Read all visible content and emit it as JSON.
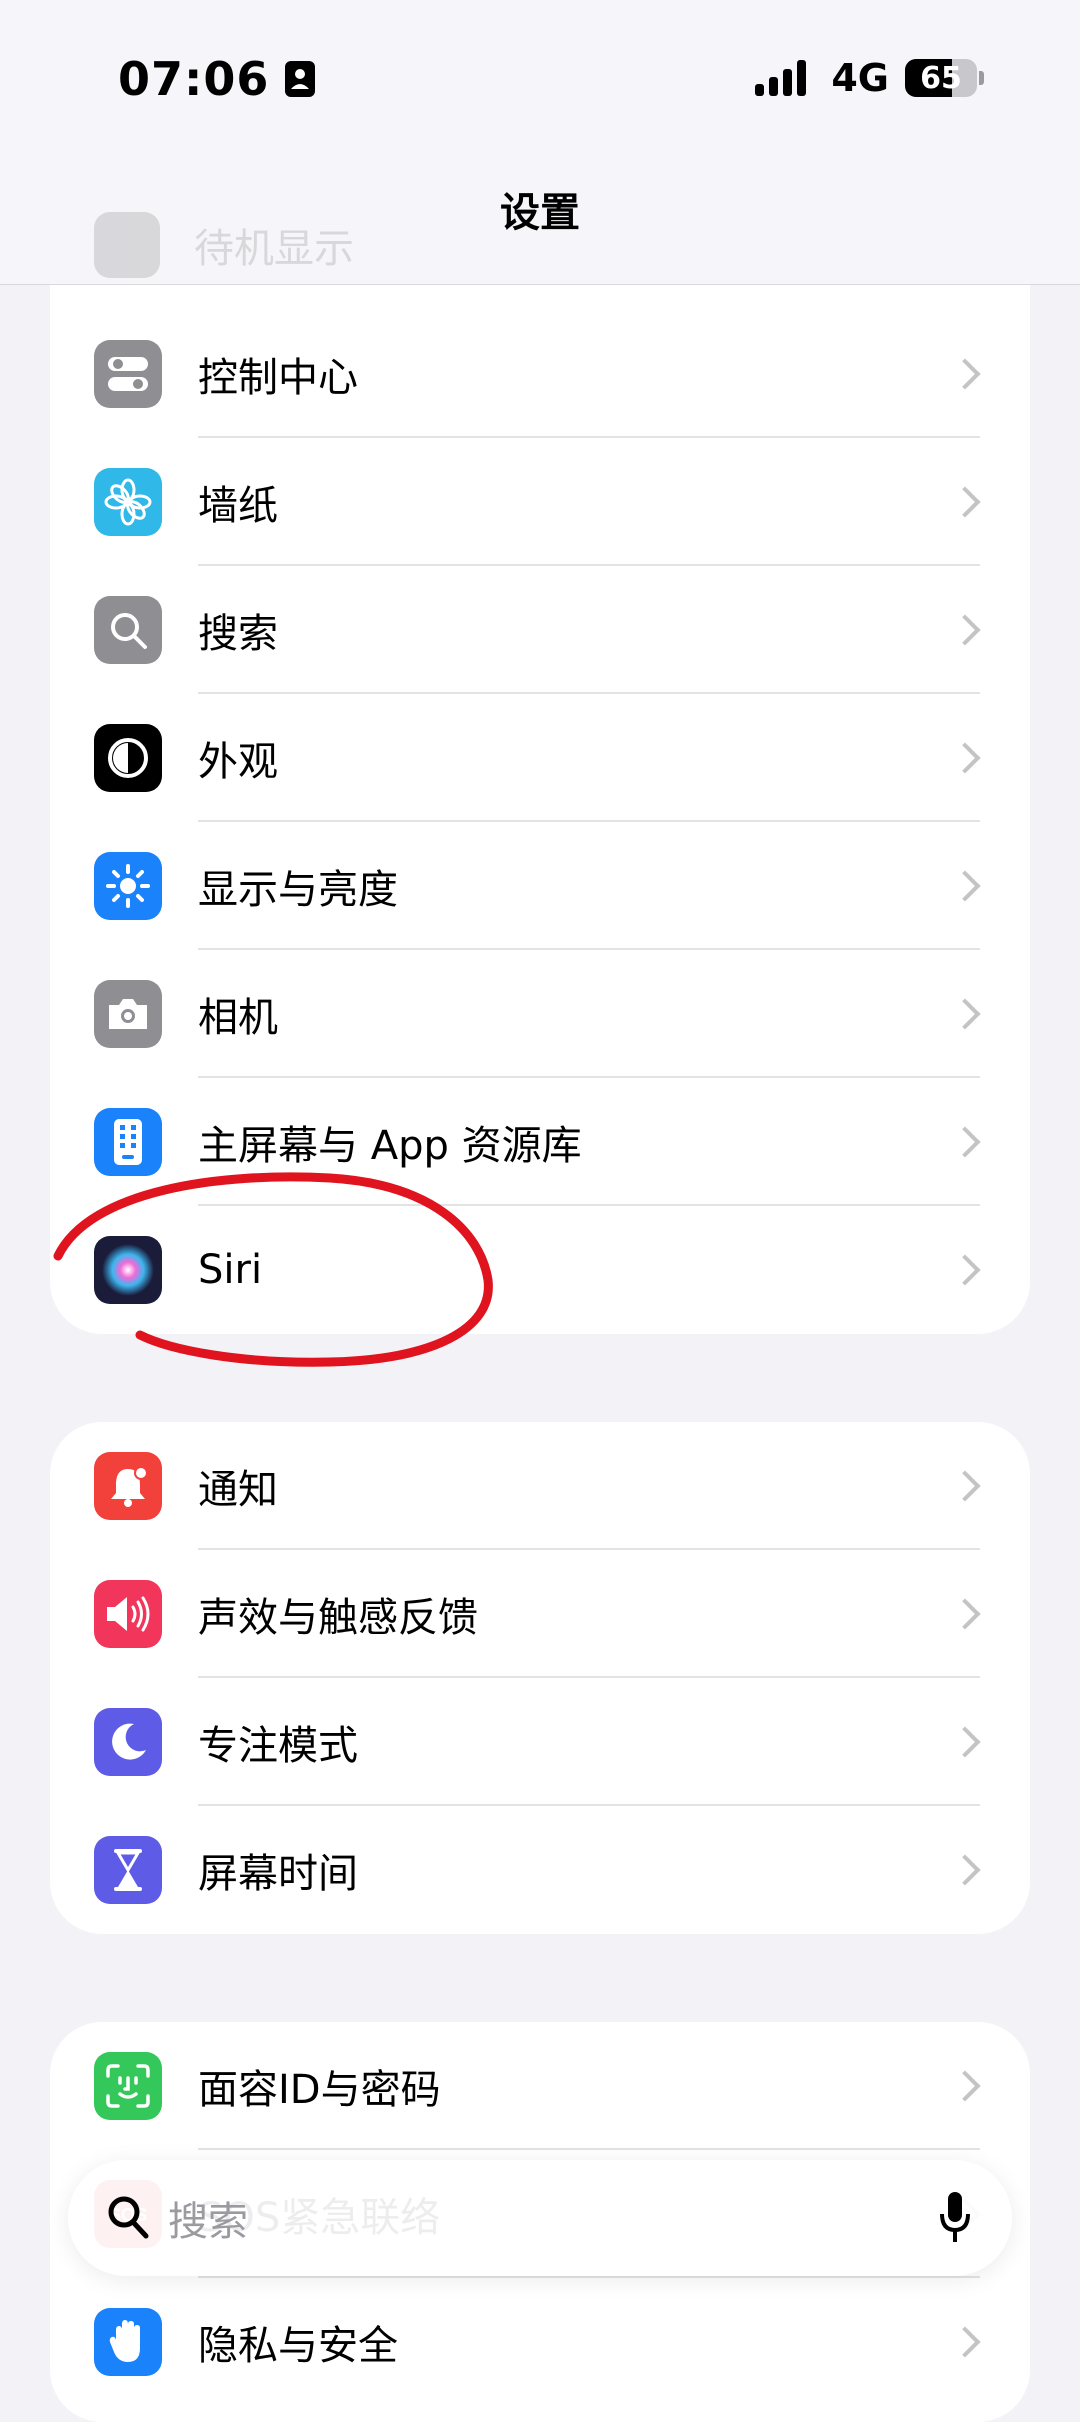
{
  "status": {
    "time": "07:06",
    "network": "4G",
    "battery": "65"
  },
  "nav": {
    "title": "设置"
  },
  "ghost_items": [
    "待机显示"
  ],
  "groups": [
    [
      {
        "label": "控制中心",
        "icon": "toggles-icon",
        "color": "#8e8e93"
      },
      {
        "label": "墙纸",
        "icon": "flower-icon",
        "color": "#2fb8e8"
      },
      {
        "label": "搜索",
        "icon": "search-icon",
        "color": "#8e8e93"
      },
      {
        "label": "外观",
        "icon": "appearance-icon",
        "color": "#000000"
      },
      {
        "label": "显示与亮度",
        "icon": "sun-icon",
        "color": "#1a82fb"
      },
      {
        "label": "相机",
        "icon": "camera-icon",
        "color": "#8e8e93"
      },
      {
        "label": "主屏幕与 App 资源库",
        "icon": "home-screen-icon",
        "color": "#1a82fb"
      },
      {
        "label": "Siri",
        "icon": "siri-icon",
        "color": "#1b1b3a"
      }
    ],
    [
      {
        "label": "通知",
        "icon": "bell-icon",
        "color": "#f2403a"
      },
      {
        "label": "声效与触感反馈",
        "icon": "speaker-icon",
        "color": "#f2355a"
      },
      {
        "label": "专注模式",
        "icon": "moon-icon",
        "color": "#5e5ce6"
      },
      {
        "label": "屏幕时间",
        "icon": "hourglass-icon",
        "color": "#5e5ce6"
      }
    ],
    [
      {
        "label": "面容ID与密码",
        "icon": "faceid-icon",
        "color": "#34c759"
      },
      {
        "label": "SOS紧急联络",
        "icon": "sos-icon",
        "color": "#f2403a"
      },
      {
        "label": "隐私与安全",
        "icon": "hand-icon",
        "color": "#1a82fb"
      }
    ]
  ],
  "search": {
    "placeholder": "搜索"
  }
}
